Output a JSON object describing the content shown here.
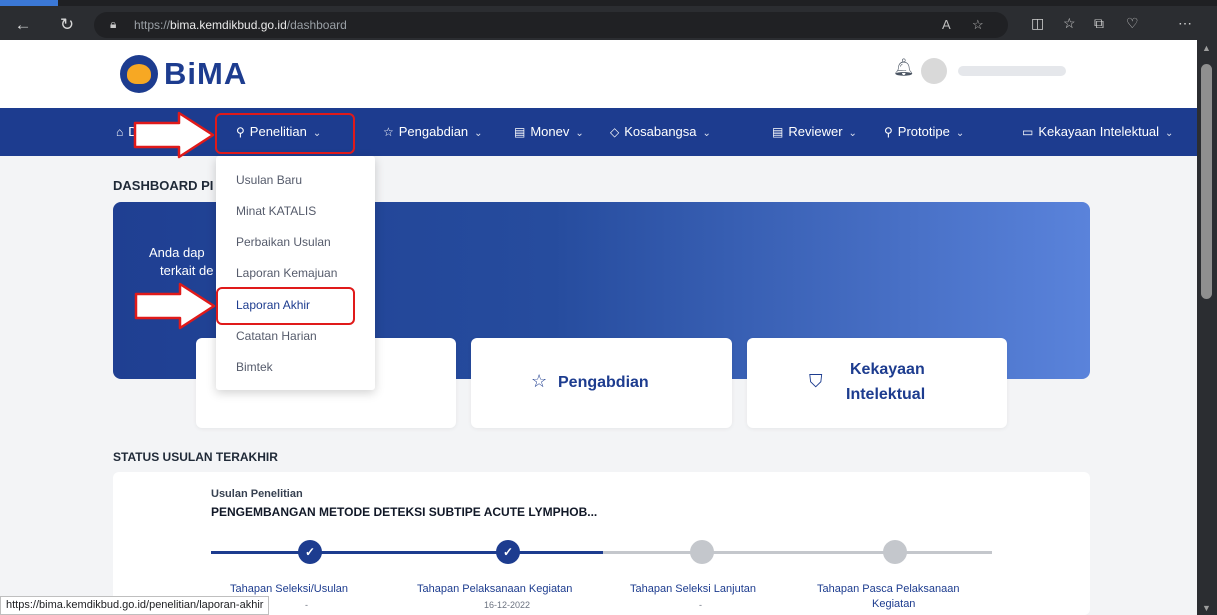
{
  "browser": {
    "url_prefix": "https://",
    "url_domain": "bima.kemdikbud.go.id",
    "url_path": "/dashboard",
    "status_url": "https://bima.kemdikbud.go.id/penelitian/laporan-akhir"
  },
  "header": {
    "logo_text": "BiMA"
  },
  "nav": {
    "items": [
      {
        "label": "D",
        "icon": "home-icon"
      },
      {
        "label": "Penelitian",
        "icon": "search-icon"
      },
      {
        "label": "Pengabdian",
        "icon": "star-icon"
      },
      {
        "label": "Monev",
        "icon": "document-icon"
      },
      {
        "label": "Kosabangsa",
        "icon": "diamond-icon"
      },
      {
        "label": "Reviewer",
        "icon": "document-icon"
      },
      {
        "label": "Prototipe",
        "icon": "search-icon"
      },
      {
        "label": "Kekayaan Intelektual",
        "icon": "box-icon"
      }
    ]
  },
  "dropdown": {
    "items": [
      "Usulan Baru",
      "Minat KATALIS",
      "Perbaikan Usulan",
      "Laporan Kemajuan",
      "Laporan Akhir",
      "Catatan Harian",
      "Bimtek"
    ],
    "active_index": 4
  },
  "dashboard": {
    "title_partial": "DASHBOARD PI",
    "hero_line1": "Anda dap",
    "hero_line2": "terkait de",
    "cards": [
      {
        "label": "Pengabdian",
        "icon": "star-icon"
      },
      {
        "label_line1": "Kekayaan",
        "label_line2": "Intelektual",
        "icon": "bookmark-icon"
      }
    ]
  },
  "status": {
    "section_title": "STATUS USULAN TERAKHIR",
    "usulan_label": "Usulan Penelitian",
    "usulan_title": "PENGEMBANGAN METODE DETEKSI SUBTIPE ACUTE LYMPHOB...",
    "steps": [
      {
        "label": "Tahapan Seleksi/Usulan",
        "sub": "-",
        "done": true
      },
      {
        "label": "Tahapan Pelaksanaan Kegiatan",
        "sub": "16-12-2022",
        "done": true
      },
      {
        "label": "Tahapan Seleksi Lanjutan",
        "sub": "-",
        "done": false
      },
      {
        "label_line1": "Tahapan Pasca Pelaksanaan",
        "label_line2": "Kegiatan",
        "done": false
      }
    ]
  },
  "colors": {
    "brand_navy": "#1d3c8f",
    "accent_orange": "#f7a823",
    "highlight_red": "#e01a1a"
  }
}
